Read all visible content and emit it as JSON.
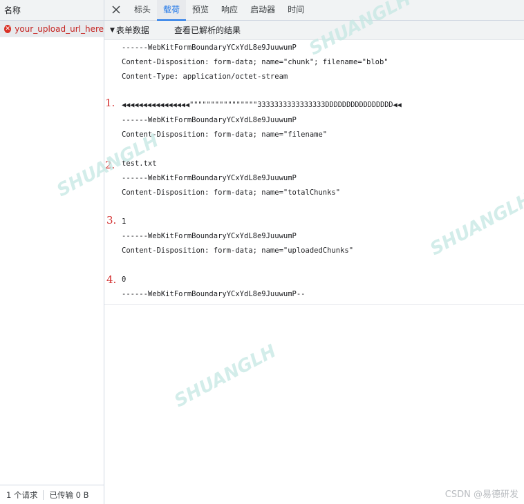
{
  "left_panel": {
    "header": "名称",
    "requests": [
      {
        "name": "your_upload_url_here",
        "status_icon": "error-x-icon"
      }
    ],
    "footer": {
      "requests": "1 个请求",
      "transferred": "已传输 0 B"
    }
  },
  "tabs": [
    {
      "label": "标头",
      "active": false
    },
    {
      "label": "载荷",
      "active": true
    },
    {
      "label": "预览",
      "active": false
    },
    {
      "label": "响应",
      "active": false
    },
    {
      "label": "启动器",
      "active": false
    },
    {
      "label": "时间",
      "active": false
    }
  ],
  "section": {
    "title": "表单数据",
    "view_parsed": "查看已解析的结果"
  },
  "payload_lines": [
    "------WebKitFormBoundaryYCxYdL8e9JuuwumP",
    "Content-Disposition: form-data; name=\"chunk\"; filename=\"blob\"",
    "Content-Type: application/octet-stream",
    "◀◀◀◀◀◀◀◀◀◀◀◀◀◀◀◀\"\"\"\"\"\"\"\"\"\"\"\"\"\"\"\"3333333333333333DDDDDDDDDDDDDDDD◀◀",
    "------WebKitFormBoundaryYCxYdL8e9JuuwumP",
    "Content-Disposition: form-data; name=\"filename\"",
    "test.txt",
    "------WebKitFormBoundaryYCxYdL8e9JuuwumP",
    "Content-Disposition: form-data; name=\"totalChunks\"",
    "1",
    "------WebKitFormBoundaryYCxYdL8e9JuuwumP",
    "Content-Disposition: form-data; name=\"uploadedChunks\"",
    "0",
    "------WebKitFormBoundaryYCxYdL8e9JuuwumP--"
  ],
  "markers": [
    "1.",
    "2.",
    "3.",
    "4."
  ],
  "watermark": "SHUANGLH",
  "csdn_credit": "CSDN @易德研发",
  "colors": {
    "accent": "#1a73e8",
    "error": "#d93025",
    "marker": "#d32f2f",
    "watermark": "#c5e8e3"
  }
}
